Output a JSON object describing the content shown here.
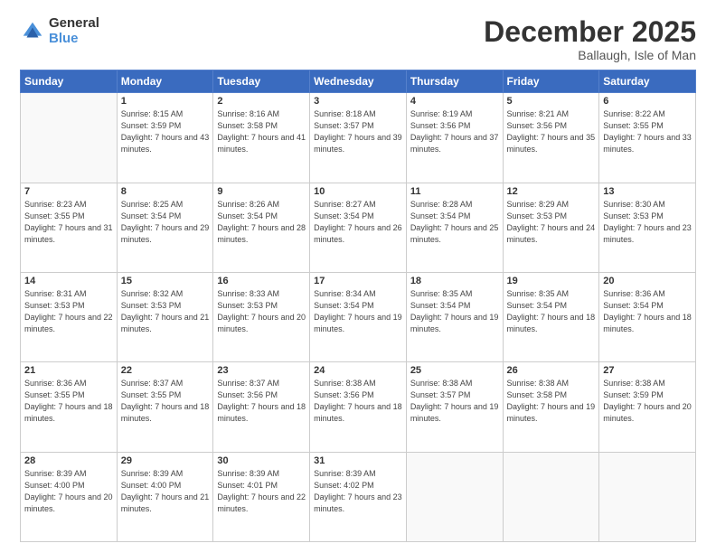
{
  "logo": {
    "general": "General",
    "blue": "Blue"
  },
  "header": {
    "title": "December 2025",
    "subtitle": "Ballaugh, Isle of Man"
  },
  "weekdays": [
    "Sunday",
    "Monday",
    "Tuesday",
    "Wednesday",
    "Thursday",
    "Friday",
    "Saturday"
  ],
  "weeks": [
    [
      {
        "day": "",
        "info": ""
      },
      {
        "day": "1",
        "info": "Sunrise: 8:15 AM\nSunset: 3:59 PM\nDaylight: 7 hours\nand 43 minutes."
      },
      {
        "day": "2",
        "info": "Sunrise: 8:16 AM\nSunset: 3:58 PM\nDaylight: 7 hours\nand 41 minutes."
      },
      {
        "day": "3",
        "info": "Sunrise: 8:18 AM\nSunset: 3:57 PM\nDaylight: 7 hours\nand 39 minutes."
      },
      {
        "day": "4",
        "info": "Sunrise: 8:19 AM\nSunset: 3:56 PM\nDaylight: 7 hours\nand 37 minutes."
      },
      {
        "day": "5",
        "info": "Sunrise: 8:21 AM\nSunset: 3:56 PM\nDaylight: 7 hours\nand 35 minutes."
      },
      {
        "day": "6",
        "info": "Sunrise: 8:22 AM\nSunset: 3:55 PM\nDaylight: 7 hours\nand 33 minutes."
      }
    ],
    [
      {
        "day": "7",
        "info": "Sunrise: 8:23 AM\nSunset: 3:55 PM\nDaylight: 7 hours\nand 31 minutes."
      },
      {
        "day": "8",
        "info": "Sunrise: 8:25 AM\nSunset: 3:54 PM\nDaylight: 7 hours\nand 29 minutes."
      },
      {
        "day": "9",
        "info": "Sunrise: 8:26 AM\nSunset: 3:54 PM\nDaylight: 7 hours\nand 28 minutes."
      },
      {
        "day": "10",
        "info": "Sunrise: 8:27 AM\nSunset: 3:54 PM\nDaylight: 7 hours\nand 26 minutes."
      },
      {
        "day": "11",
        "info": "Sunrise: 8:28 AM\nSunset: 3:54 PM\nDaylight: 7 hours\nand 25 minutes."
      },
      {
        "day": "12",
        "info": "Sunrise: 8:29 AM\nSunset: 3:53 PM\nDaylight: 7 hours\nand 24 minutes."
      },
      {
        "day": "13",
        "info": "Sunrise: 8:30 AM\nSunset: 3:53 PM\nDaylight: 7 hours\nand 23 minutes."
      }
    ],
    [
      {
        "day": "14",
        "info": "Sunrise: 8:31 AM\nSunset: 3:53 PM\nDaylight: 7 hours\nand 22 minutes."
      },
      {
        "day": "15",
        "info": "Sunrise: 8:32 AM\nSunset: 3:53 PM\nDaylight: 7 hours\nand 21 minutes."
      },
      {
        "day": "16",
        "info": "Sunrise: 8:33 AM\nSunset: 3:53 PM\nDaylight: 7 hours\nand 20 minutes."
      },
      {
        "day": "17",
        "info": "Sunrise: 8:34 AM\nSunset: 3:54 PM\nDaylight: 7 hours\nand 19 minutes."
      },
      {
        "day": "18",
        "info": "Sunrise: 8:35 AM\nSunset: 3:54 PM\nDaylight: 7 hours\nand 19 minutes."
      },
      {
        "day": "19",
        "info": "Sunrise: 8:35 AM\nSunset: 3:54 PM\nDaylight: 7 hours\nand 18 minutes."
      },
      {
        "day": "20",
        "info": "Sunrise: 8:36 AM\nSunset: 3:54 PM\nDaylight: 7 hours\nand 18 minutes."
      }
    ],
    [
      {
        "day": "21",
        "info": "Sunrise: 8:36 AM\nSunset: 3:55 PM\nDaylight: 7 hours\nand 18 minutes."
      },
      {
        "day": "22",
        "info": "Sunrise: 8:37 AM\nSunset: 3:55 PM\nDaylight: 7 hours\nand 18 minutes."
      },
      {
        "day": "23",
        "info": "Sunrise: 8:37 AM\nSunset: 3:56 PM\nDaylight: 7 hours\nand 18 minutes."
      },
      {
        "day": "24",
        "info": "Sunrise: 8:38 AM\nSunset: 3:56 PM\nDaylight: 7 hours\nand 18 minutes."
      },
      {
        "day": "25",
        "info": "Sunrise: 8:38 AM\nSunset: 3:57 PM\nDaylight: 7 hours\nand 19 minutes."
      },
      {
        "day": "26",
        "info": "Sunrise: 8:38 AM\nSunset: 3:58 PM\nDaylight: 7 hours\nand 19 minutes."
      },
      {
        "day": "27",
        "info": "Sunrise: 8:38 AM\nSunset: 3:59 PM\nDaylight: 7 hours\nand 20 minutes."
      }
    ],
    [
      {
        "day": "28",
        "info": "Sunrise: 8:39 AM\nSunset: 4:00 PM\nDaylight: 7 hours\nand 20 minutes."
      },
      {
        "day": "29",
        "info": "Sunrise: 8:39 AM\nSunset: 4:00 PM\nDaylight: 7 hours\nand 21 minutes."
      },
      {
        "day": "30",
        "info": "Sunrise: 8:39 AM\nSunset: 4:01 PM\nDaylight: 7 hours\nand 22 minutes."
      },
      {
        "day": "31",
        "info": "Sunrise: 8:39 AM\nSunset: 4:02 PM\nDaylight: 7 hours\nand 23 minutes."
      },
      {
        "day": "",
        "info": ""
      },
      {
        "day": "",
        "info": ""
      },
      {
        "day": "",
        "info": ""
      }
    ]
  ]
}
